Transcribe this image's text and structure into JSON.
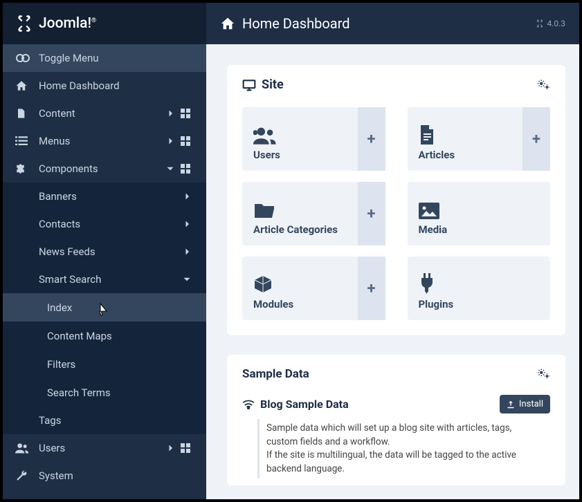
{
  "brand": "Joomla!",
  "version": "4.0.3",
  "topbar": {
    "title": "Home Dashboard"
  },
  "sidebar": {
    "toggle": "Toggle Menu",
    "home": "Home Dashboard",
    "content": "Content",
    "menus": "Menus",
    "components": "Components",
    "sub": {
      "banners": "Banners",
      "contacts": "Contacts",
      "newsfeeds": "News Feeds",
      "smartsearch": "Smart Search",
      "ss": {
        "index": "Index",
        "contentmaps": "Content Maps",
        "filters": "Filters",
        "searchterms": "Search Terms"
      },
      "tags": "Tags"
    },
    "users": "Users",
    "system": "System"
  },
  "site": {
    "title": "Site",
    "cards": {
      "users": "Users",
      "articles": "Articles",
      "categories": "Article Categories",
      "media": "Media",
      "modules": "Modules",
      "plugins": "Plugins"
    }
  },
  "sample": {
    "title": "Sample Data",
    "blog": {
      "title": "Blog Sample Data",
      "install": "Install",
      "desc1": "Sample data which will set up a blog site with articles, tags, custom fields and a workflow.",
      "desc2": "If the site is multilingual, the data will be tagged to the active backend language."
    }
  }
}
